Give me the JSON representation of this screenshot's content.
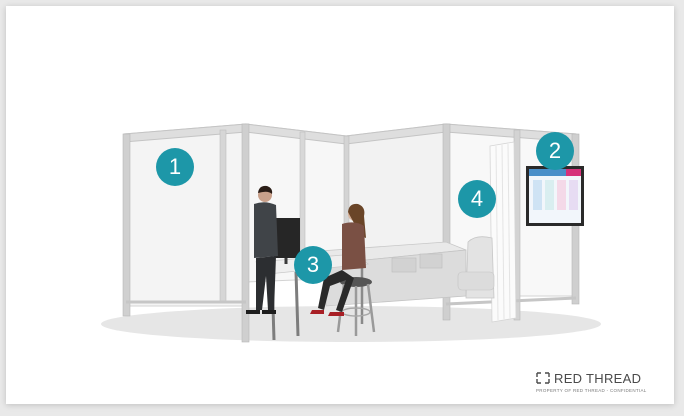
{
  "callouts": [
    {
      "number": "1"
    },
    {
      "number": "2"
    },
    {
      "number": "3"
    },
    {
      "number": "4"
    }
  ],
  "logo": {
    "text": "RED THREAD",
    "subtext": "PROPERTY OF RED THREAD - CONFIDENTIAL"
  },
  "colors": {
    "callout": "#1d97a8",
    "panel": "#f5f5f5",
    "frame": "#c9c9c9",
    "desk": "#eeeeee",
    "screen": "#2a2a2a"
  }
}
